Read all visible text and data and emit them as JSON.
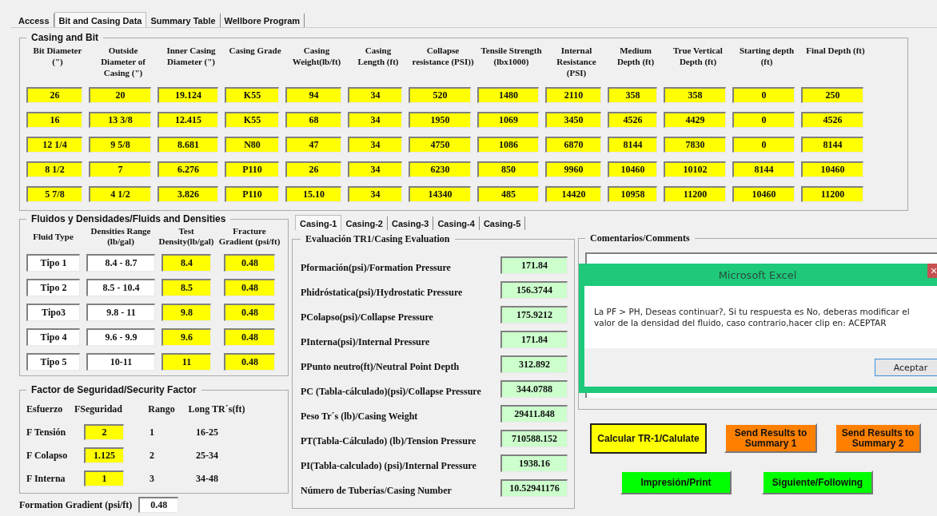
{
  "tabs": [
    {
      "label": "Access",
      "selected": false
    },
    {
      "label": "Bit and Casing Data",
      "selected": true
    },
    {
      "label": "Summary Table",
      "selected": false
    },
    {
      "label": "Wellbore Program",
      "selected": false
    }
  ],
  "casing_bit": {
    "title": "Casing and Bit",
    "columns": [
      "Bit Diameter (\")",
      "Outside Diameter of Casing (\")",
      "Inner Casing Diameter (\")",
      "Casing Grade",
      "Casing Weight(lb/ft)",
      "Casing Length (ft)",
      "Collapse resistance (PSI))",
      "Tensile Strength (lbx1000)",
      "Internal Resistance (PSI)",
      "Medium Depth (ft)",
      "True Vertical Depth (ft)",
      "Starting depth (ft)",
      "Final Depth (ft)"
    ],
    "rows": [
      [
        "26",
        "20",
        "19.124",
        "K55",
        "94",
        "34",
        "520",
        "1480",
        "2110",
        "358",
        "358",
        "0",
        "250"
      ],
      [
        "16",
        "13 3/8",
        "12.415",
        "K55",
        "68",
        "34",
        "1950",
        "1069",
        "3450",
        "4526",
        "4429",
        "0",
        "4526"
      ],
      [
        "12 1/4",
        "9 5/8",
        "8.681",
        "N80",
        "47",
        "34",
        "4750",
        "1086",
        "6870",
        "8144",
        "7830",
        "0",
        "8144"
      ],
      [
        "8 1/2",
        "7",
        "6.276",
        "P110",
        "26",
        "34",
        "6230",
        "850",
        "9960",
        "10460",
        "10102",
        "8144",
        "10460"
      ],
      [
        "5 7/8",
        "4 1/2",
        "3.826",
        "P110",
        "15.10",
        "34",
        "14340",
        "485",
        "14420",
        "10958",
        "11200",
        "10460",
        "11200"
      ]
    ]
  },
  "fluids": {
    "title": "Fluidos y Densidades/Fluids and Densities",
    "columns": [
      "Fluid Type",
      "Densities Range (lb/gal)",
      "Test Density(lb/gal)",
      "Fracture Gradient (psi/ft)"
    ],
    "rows": [
      [
        "Tipo 1",
        "8.4 - 8.7",
        "8.4",
        "0.48"
      ],
      [
        "Tipo 2",
        "8.5 - 10.4",
        "8.5",
        "0.48"
      ],
      [
        "Tipo3",
        "9.8 - 11",
        "9.8",
        "0.48"
      ],
      [
        "Tipo 4",
        "9.6 - 9.9",
        "9.6",
        "0.48"
      ],
      [
        "Tipo 5",
        "10-11",
        "11",
        "0.48"
      ]
    ]
  },
  "security": {
    "title": "Factor de Seguridad/Security Factor",
    "headers": [
      "Esfuerzo",
      "FSeguridad",
      "Rango",
      "Long TR´s(ft)"
    ],
    "rows": [
      {
        "label": "F Tensión",
        "value": "2",
        "rango": "1",
        "long": "16-25"
      },
      {
        "label": "F Colapso",
        "value": "1.125",
        "rango": "2",
        "long": "25-34"
      },
      {
        "label": "F Interna",
        "value": "1",
        "rango": "3",
        "long": "34-48"
      }
    ]
  },
  "formation_gradient": {
    "label": "Formation Gradient (psi/ft)",
    "value": "0.48"
  },
  "casing_tabs": [
    {
      "label": "Casing-1",
      "selected": true
    },
    {
      "label": "Casing-2",
      "selected": false
    },
    {
      "label": "Casing-3",
      "selected": false
    },
    {
      "label": "Casing-4",
      "selected": false
    },
    {
      "label": "Casing-5",
      "selected": false
    }
  ],
  "evaluation": {
    "title": "Evaluación TR1/Casing Evaluation",
    "rows": [
      {
        "label": "Pformación(psi)/Formation Pressure",
        "value": "171.84"
      },
      {
        "label": "Phidróstatica(psi)/Hydrostatic Pressure",
        "value": "156.3744"
      },
      {
        "label": "PColapso(psi)/Collapse Pressure",
        "value": "175.9212"
      },
      {
        "label": "PInterna(psi)/Internal Pressure",
        "value": "171.84"
      },
      {
        "label": "PPunto neutro(ft)/Neutral Point Depth",
        "value": "312.892"
      },
      {
        "label": "PC (Tabla-cálculado)(psi)/Collapse Pressure",
        "value": "344.0788"
      },
      {
        "label": "Peso Tr´s (lb)/Casing Weight",
        "value": "29411.848"
      },
      {
        "label": "PT(Tabla-Cálculado) (lb)/Tension Pressure",
        "value": "710588.152"
      },
      {
        "label": "PI(Tabla-calculado) (psi)/Internal Pressure",
        "value": "1938.16"
      },
      {
        "label": "Número de Tuberías/Casing Number",
        "value": "10.52941176"
      }
    ]
  },
  "comments": {
    "title": "Comentarios/Comments"
  },
  "buttons": [
    {
      "label": "Calcular TR-1/Calulate",
      "color": "#ffff00"
    },
    {
      "label": "Send Results to Summary 1",
      "color": "#ff8000"
    },
    {
      "label": "Send Results to Summary 2",
      "color": "#ff8000"
    },
    {
      "label": "Impresión/Print",
      "color": "#00ff00"
    },
    {
      "label": "Siguiente/Following",
      "color": "#00ff00"
    }
  ],
  "dialog": {
    "title": "Microsoft Excel",
    "message": "La PF > PH, Deseas continuar?, Si tu respuesta es No, deberas modificar el valor de la densidad del fluido, caso contrario,hacer clip en: ACEPTAR",
    "button": "Aceptar",
    "close": "×"
  }
}
